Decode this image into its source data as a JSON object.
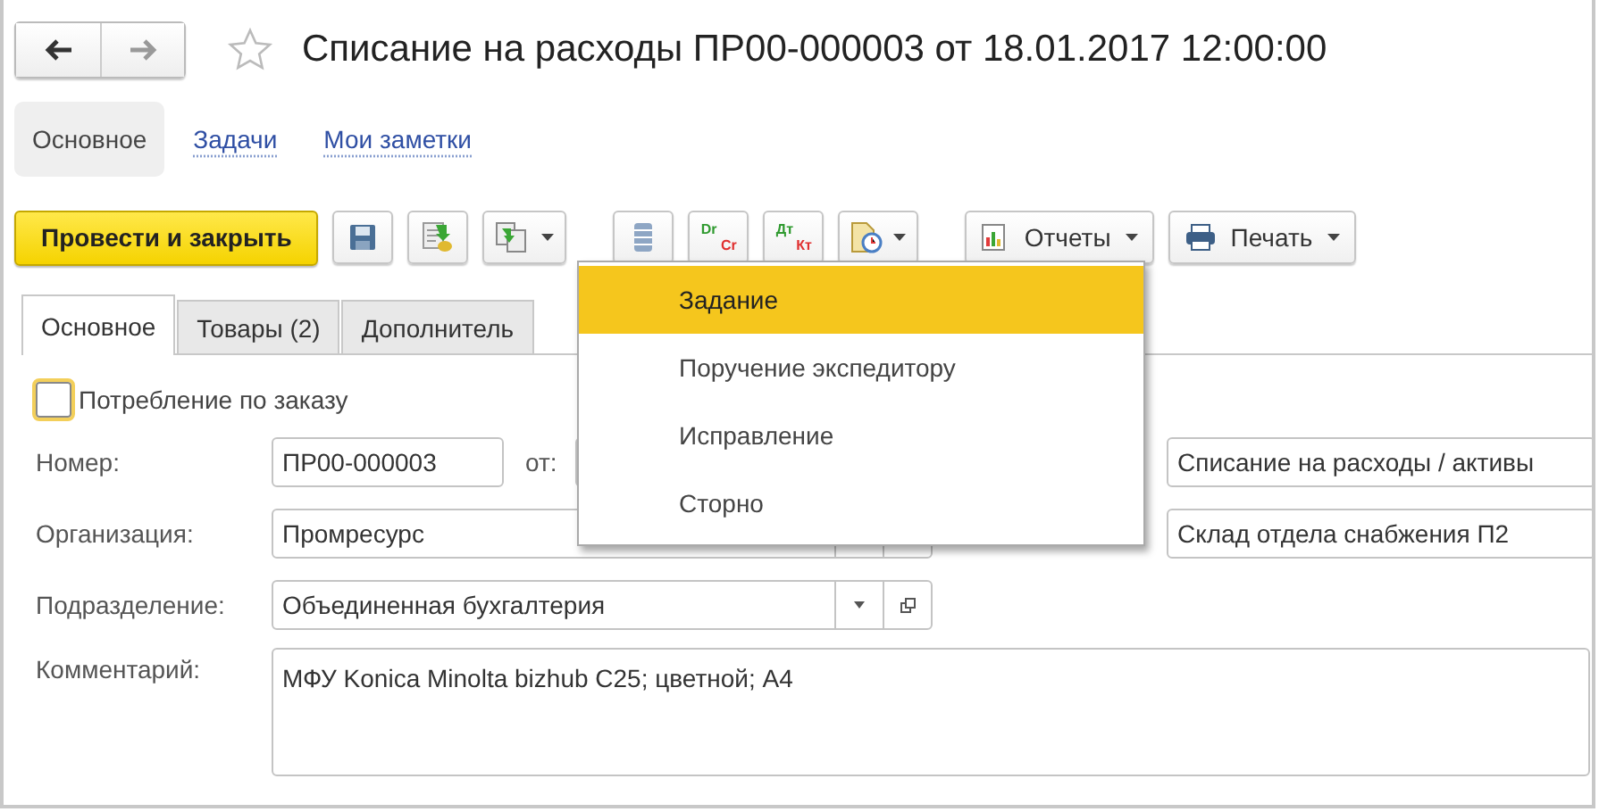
{
  "window": {
    "title": "Списание на расходы ПР00-000003 от 18.01.2017 12:00:00",
    "favorite": false
  },
  "sections": [
    {
      "label": "Основное",
      "selected": true
    },
    {
      "label": "Задачи",
      "selected": false
    },
    {
      "label": "Мои заметки",
      "selected": false
    }
  ],
  "toolbar": {
    "primary": "Провести и закрыть",
    "dr": "Dr",
    "cr": "Cr",
    "dt": "Дт",
    "kt": "Кт",
    "reports": "Отчеты",
    "print": "Печать"
  },
  "dropdown_menu": [
    {
      "label": "Задание",
      "selected": true
    },
    {
      "label": "Поручение экспедитору",
      "selected": false
    },
    {
      "label": "Исправление",
      "selected": false
    },
    {
      "label": "Сторно",
      "selected": false
    }
  ],
  "tabs": [
    {
      "label": "Основное",
      "selected": true
    },
    {
      "label": "Товары (2)",
      "selected": false
    },
    {
      "label": "Дополнитель",
      "selected": false
    }
  ],
  "form": {
    "by_order": {
      "label": "Потребление по заказу",
      "checked": false
    },
    "number": {
      "label": "Номер:",
      "value": "ПР00-000003"
    },
    "date": {
      "label": "от:"
    },
    "operation": {
      "value": "Списание на расходы / активы"
    },
    "organization": {
      "label": "Организация:",
      "value": "Промресурс"
    },
    "warehouse": {
      "value": "Склад отдела снабжения П2"
    },
    "department": {
      "label": "Подразделение:",
      "value": "Объединенная бухгалтерия"
    },
    "comment": {
      "label": "Комментарий:",
      "value": "МФУ Konica Minolta bizhub C25; цветной; А4"
    }
  }
}
